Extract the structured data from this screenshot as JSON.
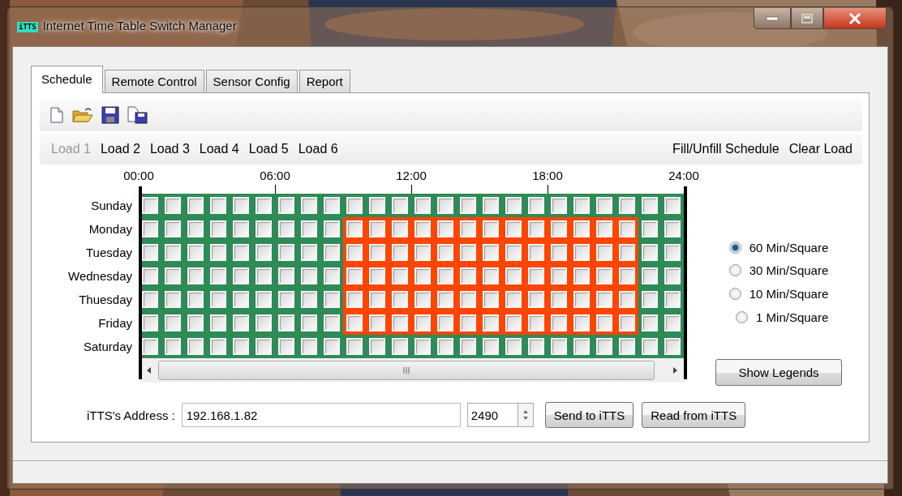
{
  "window": {
    "title": "Internet Time Table Switch Manager",
    "app_icon": "iTTS"
  },
  "tabs": [
    {
      "label": "Schedule",
      "selected": true
    },
    {
      "label": "Remote Control",
      "selected": false
    },
    {
      "label": "Sensor Config",
      "selected": false
    },
    {
      "label": "Report",
      "selected": false
    }
  ],
  "loads": [
    {
      "label": "Load 1",
      "selected": true
    },
    {
      "label": "Load 2",
      "selected": false
    },
    {
      "label": "Load 3",
      "selected": false
    },
    {
      "label": "Load 4",
      "selected": false
    },
    {
      "label": "Load 5",
      "selected": false
    },
    {
      "label": "Load 6",
      "selected": false
    }
  ],
  "load_actions": [
    "Fill/Unfill Schedule",
    "Clear Load"
  ],
  "schedule": {
    "times": [
      "00:00",
      "06:00",
      "12:00",
      "18:00",
      "24:00"
    ],
    "rows": [
      {
        "day": "Sunday",
        "on": [
          false,
          false,
          false,
          false,
          false,
          false,
          false,
          false,
          false,
          false,
          false,
          false,
          false,
          false,
          false,
          false,
          false,
          false,
          false,
          false,
          false,
          false,
          false,
          false
        ]
      },
      {
        "day": "Monday",
        "on": [
          false,
          false,
          false,
          false,
          false,
          false,
          false,
          false,
          false,
          true,
          true,
          true,
          true,
          true,
          true,
          true,
          true,
          true,
          true,
          true,
          true,
          true,
          false,
          false
        ]
      },
      {
        "day": "Tuesday",
        "on": [
          false,
          false,
          false,
          false,
          false,
          false,
          false,
          false,
          false,
          true,
          true,
          true,
          true,
          true,
          true,
          true,
          true,
          true,
          true,
          true,
          true,
          true,
          false,
          false
        ]
      },
      {
        "day": "Wednesday",
        "on": [
          false,
          false,
          false,
          false,
          false,
          false,
          false,
          false,
          false,
          true,
          true,
          true,
          true,
          true,
          true,
          true,
          true,
          true,
          true,
          true,
          true,
          true,
          false,
          false
        ]
      },
      {
        "day": "Thuesday",
        "on": [
          false,
          false,
          false,
          false,
          false,
          false,
          false,
          false,
          false,
          true,
          true,
          true,
          true,
          true,
          true,
          true,
          true,
          true,
          true,
          true,
          true,
          true,
          false,
          false
        ]
      },
      {
        "day": "Friday",
        "on": [
          false,
          false,
          false,
          false,
          false,
          false,
          false,
          false,
          false,
          true,
          true,
          true,
          true,
          true,
          true,
          true,
          true,
          true,
          true,
          true,
          true,
          true,
          false,
          false
        ]
      },
      {
        "day": "Saturday",
        "on": [
          false,
          false,
          false,
          false,
          false,
          false,
          false,
          false,
          false,
          false,
          false,
          false,
          false,
          false,
          false,
          false,
          false,
          false,
          false,
          false,
          false,
          false,
          false,
          false
        ]
      }
    ]
  },
  "resolutions": [
    {
      "label": "60 Min/Square",
      "selected": true
    },
    {
      "label": "30 Min/Square",
      "selected": false
    },
    {
      "label": "10 Min/Square",
      "selected": false
    },
    {
      "label": "1 Min/Square",
      "selected": false
    }
  ],
  "show_legends_button": "Show Legends",
  "address": {
    "label": "iTTS's Address :",
    "value": "192.168.1.82",
    "port": "2490"
  },
  "buttons": [
    "Send to iTTS",
    "Read from iTTS"
  ]
}
